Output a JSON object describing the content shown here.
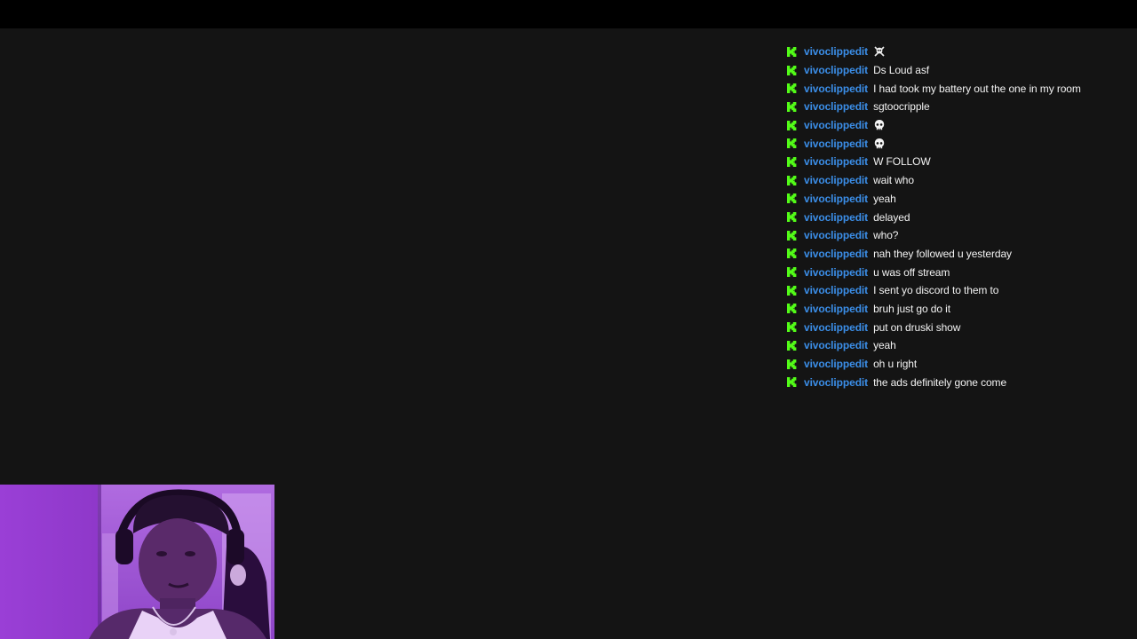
{
  "chat": {
    "messages": [
      {
        "user": "vivoclippedit",
        "text": "",
        "emote": "crossbones-emote"
      },
      {
        "user": "vivoclippedit",
        "text": "Ds Loud asf"
      },
      {
        "user": "vivoclippedit",
        "text": "I had took my battery out the one in my room"
      },
      {
        "user": "vivoclippedit",
        "text": "sgtoocripple"
      },
      {
        "user": "vivoclippedit",
        "text": "",
        "emote": "skull-emote"
      },
      {
        "user": "vivoclippedit",
        "text": "",
        "emote": "skull-emote"
      },
      {
        "user": "vivoclippedit",
        "text": "W FOLLOW"
      },
      {
        "user": "vivoclippedit",
        "text": "wait who"
      },
      {
        "user": "vivoclippedit",
        "text": "yeah"
      },
      {
        "user": "vivoclippedit",
        "text": "delayed"
      },
      {
        "user": "vivoclippedit",
        "text": "who?"
      },
      {
        "user": "vivoclippedit",
        "text": "nah they followed u yesterday"
      },
      {
        "user": "vivoclippedit",
        "text": "u was off stream"
      },
      {
        "user": "vivoclippedit",
        "text": "I sent yo discord to them to"
      },
      {
        "user": "vivoclippedit",
        "text": "bruh just go do it"
      },
      {
        "user": "vivoclippedit",
        "text": "put on druski show"
      },
      {
        "user": "vivoclippedit",
        "text": "yeah"
      },
      {
        "user": "vivoclippedit",
        "text": "oh u right"
      },
      {
        "user": "vivoclippedit",
        "text": "the ads definitely gone come"
      }
    ],
    "badge_icon": "kick-badge-icon",
    "colors": {
      "username": "#3b8ee8",
      "message": "#f2f2f2",
      "badge": "#53fc18",
      "background": "#141414"
    }
  },
  "webcam": {
    "icon": "webcam-feed-image"
  }
}
